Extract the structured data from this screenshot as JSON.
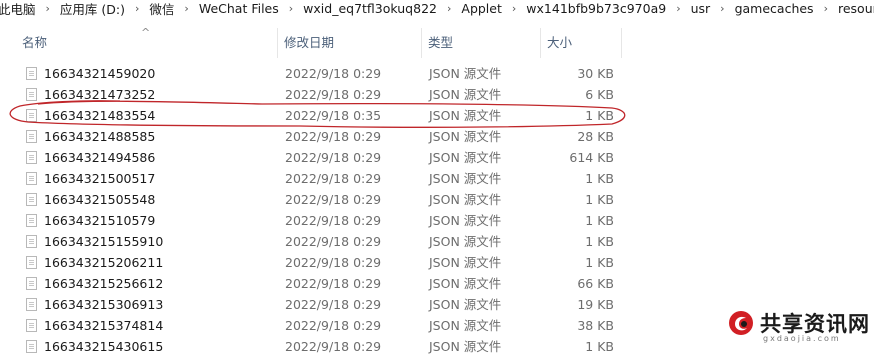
{
  "breadcrumb": {
    "items": [
      "此电脑",
      "应用库 (D:)",
      "微信",
      "WeChat Files",
      "wxid_eq7tfl3okuq822",
      "Applet",
      "wx141bfb9b73c970a9",
      "usr",
      "gamecaches",
      "resources"
    ],
    "separator": "›"
  },
  "columns": {
    "name": "名称",
    "date": "修改日期",
    "type": "类型",
    "size": "大小"
  },
  "sort_indicator": "^",
  "files": [
    {
      "name": "16634321459020",
      "date": "2022/9/18 0:29",
      "type": "JSON 源文件",
      "size": "30 KB"
    },
    {
      "name": "16634321473252",
      "date": "2022/9/18 0:29",
      "type": "JSON 源文件",
      "size": "6 KB"
    },
    {
      "name": "16634321483554",
      "date": "2022/9/18 0:35",
      "type": "JSON 源文件",
      "size": "1 KB"
    },
    {
      "name": "16634321488585",
      "date": "2022/9/18 0:29",
      "type": "JSON 源文件",
      "size": "28 KB"
    },
    {
      "name": "16634321494586",
      "date": "2022/9/18 0:29",
      "type": "JSON 源文件",
      "size": "614 KB"
    },
    {
      "name": "16634321500517",
      "date": "2022/9/18 0:29",
      "type": "JSON 源文件",
      "size": "1 KB"
    },
    {
      "name": "16634321505548",
      "date": "2022/9/18 0:29",
      "type": "JSON 源文件",
      "size": "1 KB"
    },
    {
      "name": "16634321510579",
      "date": "2022/9/18 0:29",
      "type": "JSON 源文件",
      "size": "1 KB"
    },
    {
      "name": "166343215155910",
      "date": "2022/9/18 0:29",
      "type": "JSON 源文件",
      "size": "1 KB"
    },
    {
      "name": "166343215206211",
      "date": "2022/9/18 0:29",
      "type": "JSON 源文件",
      "size": "1 KB"
    },
    {
      "name": "166343215256612",
      "date": "2022/9/18 0:29",
      "type": "JSON 源文件",
      "size": "66 KB"
    },
    {
      "name": "166343215306913",
      "date": "2022/9/18 0:29",
      "type": "JSON 源文件",
      "size": "19 KB"
    },
    {
      "name": "166343215374814",
      "date": "2022/9/18 0:29",
      "type": "JSON 源文件",
      "size": "38 KB"
    },
    {
      "name": "166343215430615",
      "date": "2022/9/18 0:29",
      "type": "JSON 源文件",
      "size": "1 KB"
    }
  ],
  "watermark": {
    "title": "共享资讯网",
    "subtitle": "gxdaojia.com"
  },
  "colors": {
    "annotation": "#c0262a",
    "header_text": "#4c607a",
    "secondary_text": "#6d6d6d"
  }
}
